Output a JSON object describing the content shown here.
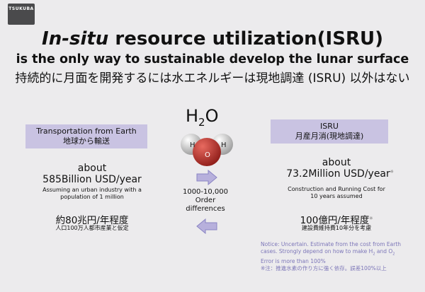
{
  "logo": {
    "text": "TSUKUBA"
  },
  "title": {
    "part1": "In-situ",
    "part2": " resource utilization(ISRU)"
  },
  "subtitle_en": "is the only way  to sustainable develop the lunar surface",
  "subtitle_jp": "持続的に月面を開発するには水エネルギーは現地調達 (ISRU) 以外はない",
  "left": {
    "box_line1": "Transportation from Earth",
    "box_line2": "地球から輸送",
    "about": "about",
    "amount": "585Billion USD/year",
    "note_line1": "Assuming an urban industry with a",
    "note_line2": "population of 1 million",
    "jp_amount": "約80兆円/年程度",
    "jp_note": "人口100万人都市産業と仮定"
  },
  "right": {
    "box_line1": "ISRU",
    "box_line2": "月産月消(現地調達)",
    "about": "about",
    "amount": "73.2Million USD/year",
    "amount_mark": "※",
    "note_line1": "Construction and Running Cost for",
    "note_line2": "10 years assumed",
    "jp_amount": "100億円/年程度",
    "jp_mark": "※",
    "jp_note": "建設費維持費10年分を考慮"
  },
  "molecule": {
    "formula_main": "H",
    "formula_sub": "2",
    "formula_end": "O",
    "atom_h": "H",
    "atom_o": "O"
  },
  "middle": {
    "line1": "1000-10,000",
    "line2": "Order",
    "line3": "differences"
  },
  "notice": {
    "line1": "Notice:  Uncertain. Estimate from the cost from Earth",
    "line2": "cases. Strongly depend on how to make H",
    "line2_sub1": "2",
    "line2_mid": " and O",
    "line2_sub2": "2",
    "line3": "Error is more than 100%",
    "line4": "※注：推進水素の作り方に強く依存。誤差100%以上"
  },
  "colors": {
    "box": "#c9c3e2",
    "arrow": "#b7b0dc",
    "oxygen": "#c4302b",
    "hydrogen": "#d8d8d8",
    "notice": "#7c76b8"
  }
}
